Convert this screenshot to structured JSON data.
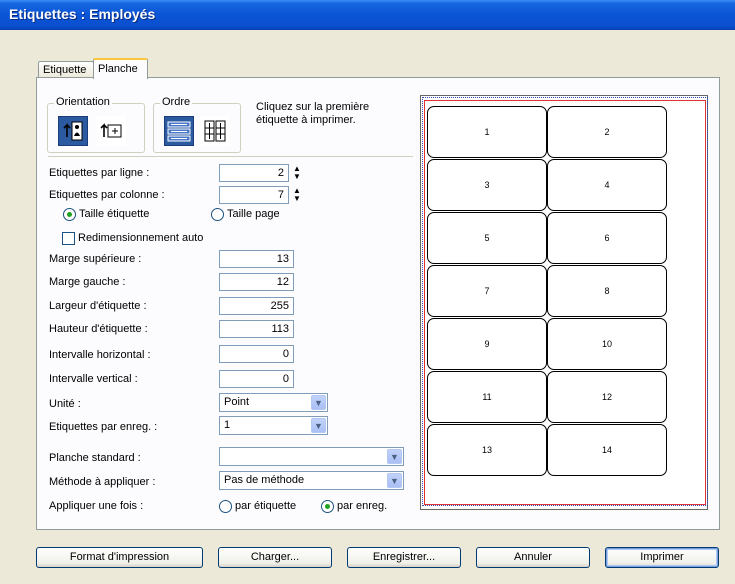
{
  "window": {
    "title": "Etiquettes : Employés"
  },
  "tabs": [
    {
      "label": "Etiquette",
      "active": false
    },
    {
      "label": "Planche",
      "active": true
    }
  ],
  "orientation": {
    "label": "Orientation",
    "options": [
      {
        "icon": "portrait-icon",
        "selected": true
      },
      {
        "icon": "landscape-icon",
        "selected": false
      }
    ]
  },
  "ordre": {
    "label": "Ordre",
    "options": [
      {
        "icon": "order-by-row-icon",
        "selected": true
      },
      {
        "icon": "order-by-column-icon",
        "selected": false
      }
    ]
  },
  "hint": "Cliquez sur la première étiquette à imprimer.",
  "fields": {
    "par_ligne": {
      "label": "Etiquettes par ligne :",
      "value": "2"
    },
    "par_colonne": {
      "label": "Etiquettes par colonne :",
      "value": "7"
    },
    "taille_etiquette": "Taille étiquette",
    "taille_page": "Taille page",
    "size_mode": "Taille étiquette",
    "redim": {
      "label": "Redimensionnement auto",
      "checked": false
    },
    "marge_sup": {
      "label": "Marge supérieure :",
      "value": "13"
    },
    "marge_gauche": {
      "label": "Marge gauche :",
      "value": "12"
    },
    "largeur": {
      "label": "Largeur d'étiquette :",
      "value": "255"
    },
    "hauteur": {
      "label": "Hauteur d'étiquette :",
      "value": "113"
    },
    "int_horiz": {
      "label": "Intervalle horizontal :",
      "value": "0"
    },
    "int_vert": {
      "label": "Intervalle vertical :",
      "value": "0"
    },
    "unite": {
      "label": "Unité :",
      "value": "Point"
    },
    "par_enreg": {
      "label": "Etiquettes par enreg. :",
      "value": "1"
    },
    "planche_std": {
      "label": "Planche standard :",
      "value": ""
    },
    "methode": {
      "label": "Méthode à appliquer :",
      "value": "Pas de méthode"
    },
    "appliquer": {
      "label": "Appliquer une fois :",
      "opt1": "par étiquette",
      "opt2": "par enreg.",
      "selected": "par enreg."
    }
  },
  "preview": {
    "cells": [
      "1",
      "2",
      "3",
      "4",
      "5",
      "6",
      "7",
      "8",
      "9",
      "10",
      "11",
      "12",
      "13",
      "14"
    ]
  },
  "buttons": {
    "format": "Format d'impression",
    "charger": "Charger...",
    "enregistrer": "Enregistrer...",
    "annuler": "Annuler",
    "imprimer": "Imprimer"
  },
  "colors": {
    "titlebar": "#0a55d6",
    "selected_icon_bg": "#2c5aa0",
    "preview_margin": "#e03030",
    "radio_dot": "#21a121"
  }
}
